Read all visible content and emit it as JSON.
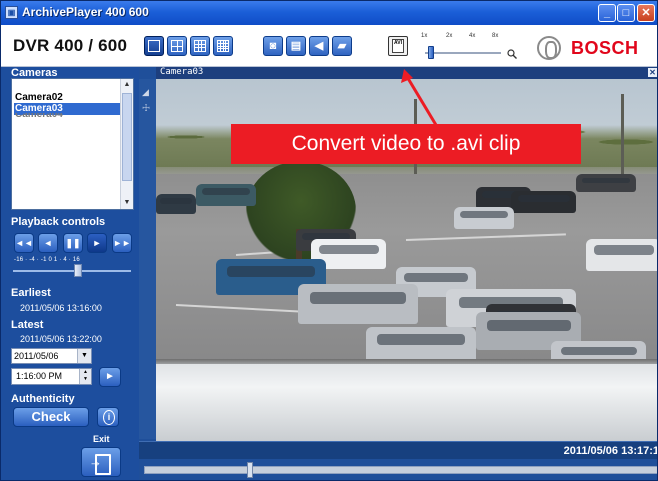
{
  "window": {
    "title": "ArchivePlayer 400 600",
    "minimize": "_",
    "maximize": "□",
    "close": "✕"
  },
  "toolbar": {
    "product_name": "DVR 400 / 600",
    "layout_buttons": [
      "single-view",
      "quad-view",
      "3x3-view",
      "4x4-view"
    ],
    "action_buttons": [
      "snapshot",
      "print",
      "audio",
      "export"
    ],
    "avi_button_text": "AVI",
    "speed_labels": [
      "1x",
      "2x",
      "4x",
      "8x"
    ],
    "brand": "BOSCH"
  },
  "cameras": {
    "label": "Cameras",
    "items": [
      "Camera02",
      "Camera03",
      "Camera04"
    ],
    "selected": "Camera03"
  },
  "playback": {
    "label": "Playback controls",
    "scale": "-16 · -4 · -1 0 1 · 4 · 16",
    "buttons": [
      "◄◄",
      "◄",
      "❚❚",
      "►",
      "►►"
    ]
  },
  "archive": {
    "earliest_label": "Earliest",
    "earliest_value": "2011/05/06 13:16:00",
    "latest_label": "Latest",
    "latest_value": "2011/05/06 13:22:00",
    "date_value": "2011/05/06",
    "time_value": "1:16:00 PM"
  },
  "authenticity": {
    "label": "Authenticity",
    "check_label": "Check"
  },
  "exit": {
    "label": "Exit"
  },
  "video": {
    "camera_title": "Camera03",
    "close": "✕",
    "timestamp": "2011/05/06 13:17:1"
  },
  "annotation": {
    "text": "Convert video to .avi clip",
    "color": "#ec1c24"
  },
  "colors": {
    "panel_blue": "#1d4e9e",
    "title_blue": "#1b5fd8",
    "brand_red": "#e1061b"
  }
}
